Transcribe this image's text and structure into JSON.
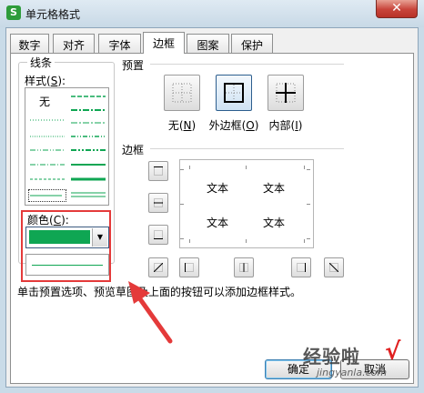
{
  "window": {
    "title": "单元格格式",
    "close_glyph": "✕",
    "app_icon_letter": "S"
  },
  "tabs": [
    {
      "label": "数字",
      "active": false
    },
    {
      "label": "对齐",
      "active": false
    },
    {
      "label": "字体",
      "active": false
    },
    {
      "label": "边框",
      "active": true
    },
    {
      "label": "图案",
      "active": false
    },
    {
      "label": "保护",
      "active": false
    }
  ],
  "line_group": {
    "title": "线条",
    "style_label": "样式(",
    "style_key": "S",
    "style_label_end": "):",
    "none_label": "无"
  },
  "color": {
    "label": "颜色(",
    "key": "C",
    "label_end": "):",
    "value": "#0fa653"
  },
  "presets": {
    "title": "预置",
    "items": [
      {
        "label": "无(",
        "key": "N",
        "end": ")"
      },
      {
        "label": "外边框(",
        "key": "O",
        "end": ")"
      },
      {
        "label": "内部(",
        "key": "I",
        "end": ")"
      }
    ]
  },
  "border": {
    "title": "边框",
    "preview_text": "文本"
  },
  "hint": "单击预置选项、预览草图及上面的按钮可以添加边框样式。",
  "buttons": {
    "ok": "确定",
    "cancel": "取消"
  },
  "watermark": {
    "text": "经验啦",
    "check": "√",
    "url": "jingyanla.com"
  }
}
